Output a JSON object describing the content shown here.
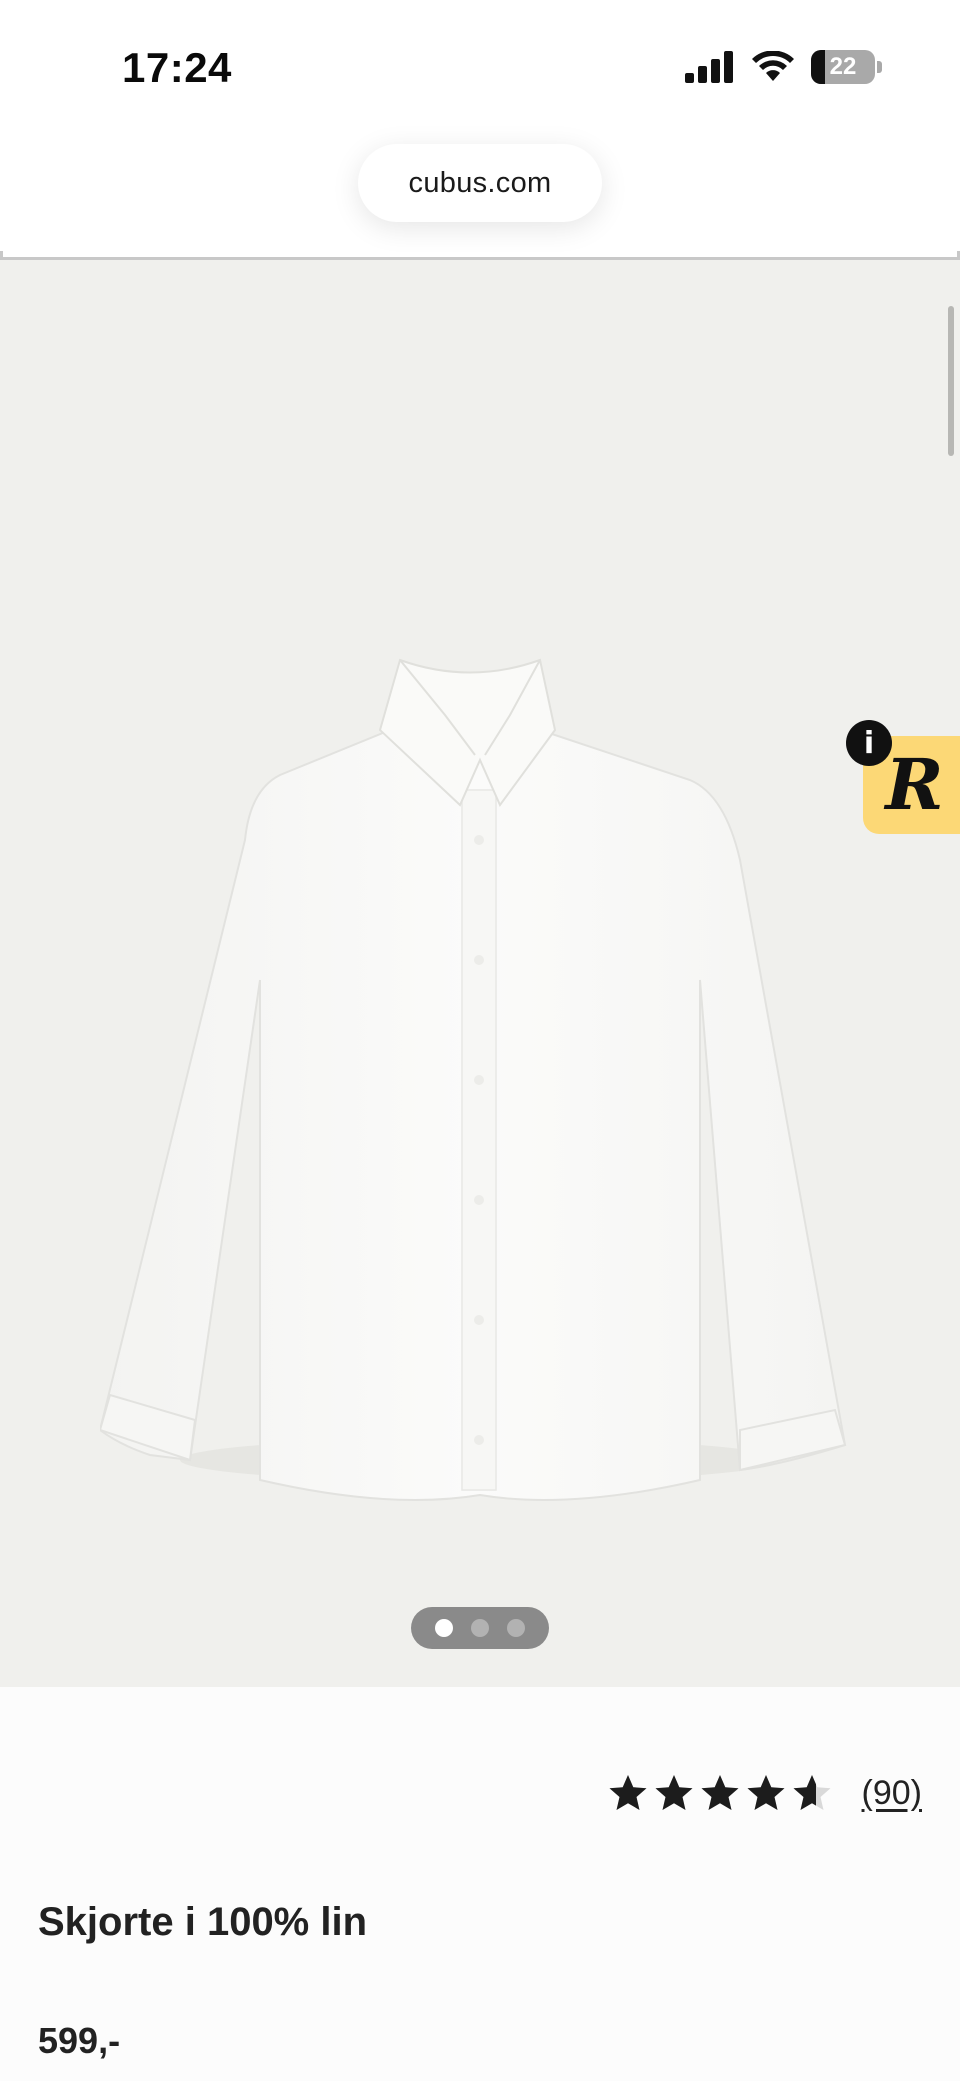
{
  "status_bar": {
    "time": "17:24",
    "battery_level": "22",
    "icons": [
      "cellular-signal-icon",
      "wifi-icon",
      "battery-icon"
    ]
  },
  "browser": {
    "url": "cubus.com"
  },
  "gallery": {
    "image": "white-linen-shirt",
    "slide_count": 3,
    "active_slide": 1,
    "background": "#f0f0ed"
  },
  "widget": {
    "letter": "R",
    "info_label": "i",
    "color": "#fcd876"
  },
  "product": {
    "rating": {
      "stars": 4.6,
      "max": 5,
      "review_count": "(90)"
    },
    "title": "Skjorte i 100% lin",
    "price": "599,-"
  }
}
